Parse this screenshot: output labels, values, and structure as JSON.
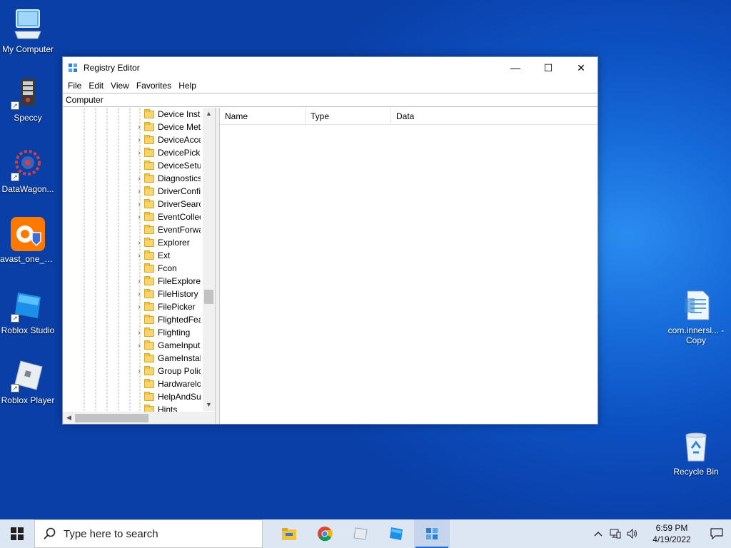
{
  "desktop": {
    "icons": [
      {
        "label": "My Computer",
        "icon": "computer-icon"
      },
      {
        "label": "Speccy",
        "icon": "speccy-icon"
      },
      {
        "label": "DataWagon...",
        "icon": "datawagon-icon"
      },
      {
        "label": "avast_one_e...",
        "icon": "avast-icon"
      },
      {
        "label": "Roblox Studio",
        "icon": "roblox-studio-icon"
      },
      {
        "label": "Roblox Player",
        "icon": "roblox-player-icon"
      },
      {
        "label": "com.innersl... - Copy",
        "icon": "text-file-icon"
      },
      {
        "label": "Recycle Bin",
        "icon": "recycle-bin-icon"
      }
    ]
  },
  "window": {
    "title": "Registry Editor",
    "minimize": "—",
    "maximize": "☐",
    "close": "✕",
    "menu": [
      "File",
      "Edit",
      "View",
      "Favorites",
      "Help"
    ],
    "address": "Computer",
    "tree": [
      {
        "label": "Device Insta",
        "expandable": false
      },
      {
        "label": "Device Met",
        "expandable": true
      },
      {
        "label": "DeviceAcce",
        "expandable": true
      },
      {
        "label": "DevicePicke",
        "expandable": true
      },
      {
        "label": "DeviceSetu",
        "expandable": false
      },
      {
        "label": "Diagnostics",
        "expandable": true
      },
      {
        "label": "DriverConfi",
        "expandable": true
      },
      {
        "label": "DriverSearc",
        "expandable": true
      },
      {
        "label": "EventCollec",
        "expandable": true
      },
      {
        "label": "EventForwa",
        "expandable": false
      },
      {
        "label": "Explorer",
        "expandable": true
      },
      {
        "label": "Ext",
        "expandable": true
      },
      {
        "label": "Fcon",
        "expandable": false
      },
      {
        "label": "FileExplorer",
        "expandable": true
      },
      {
        "label": "FileHistory",
        "expandable": true
      },
      {
        "label": "FilePicker",
        "expandable": true
      },
      {
        "label": "FlightedFea",
        "expandable": false
      },
      {
        "label": "Flighting",
        "expandable": true
      },
      {
        "label": "GameInput",
        "expandable": true
      },
      {
        "label": "GameInstal",
        "expandable": false
      },
      {
        "label": "Group Polic",
        "expandable": true
      },
      {
        "label": "Hardwarelc",
        "expandable": false
      },
      {
        "label": "HelpAndSu",
        "expandable": false
      },
      {
        "label": "Hints",
        "expandable": false
      }
    ],
    "columns": [
      "Name",
      "Type",
      "Data"
    ]
  },
  "taskbar": {
    "search_placeholder": "Type here to search",
    "time": "6:59 PM",
    "date": "4/19/2022",
    "apps": [
      "file-explorer-icon",
      "chrome-icon",
      "app-icon",
      "roblox-studio-icon",
      "regedit-icon"
    ]
  }
}
